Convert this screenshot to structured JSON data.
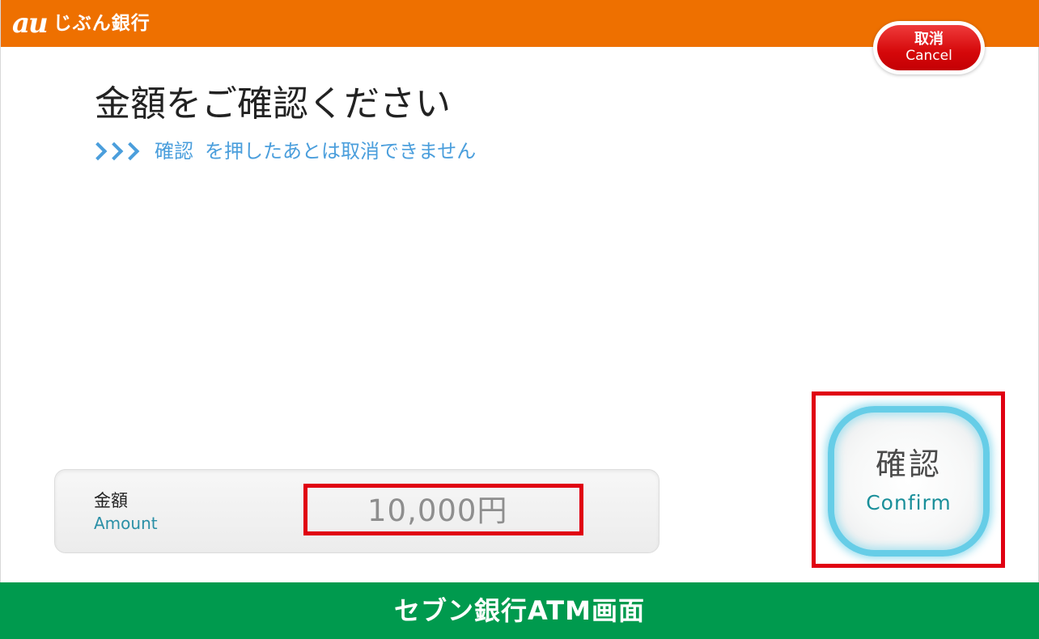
{
  "header": {
    "logo_mark": "au",
    "logo_text": "じぶん銀行",
    "cancel_label_jp": "取消",
    "cancel_label_en": "Cancel"
  },
  "main": {
    "title": "金額をご確認ください",
    "notice_keyword": "確認",
    "notice_text": "を押したあとは取消できません"
  },
  "amount": {
    "label_jp": "金額",
    "label_en": "Amount",
    "value": "10,000円"
  },
  "confirm_button": {
    "label_jp": "確認",
    "label_en": "Confirm"
  },
  "footer": {
    "caption": "セブン銀行ATM画面"
  },
  "colors": {
    "header_orange": "#ee7000",
    "cancel_red": "#d5080a",
    "notice_blue": "#4a9edc",
    "confirm_glow": "#66cde7",
    "highlight_red": "#e00012",
    "footer_green": "#009a4e"
  }
}
